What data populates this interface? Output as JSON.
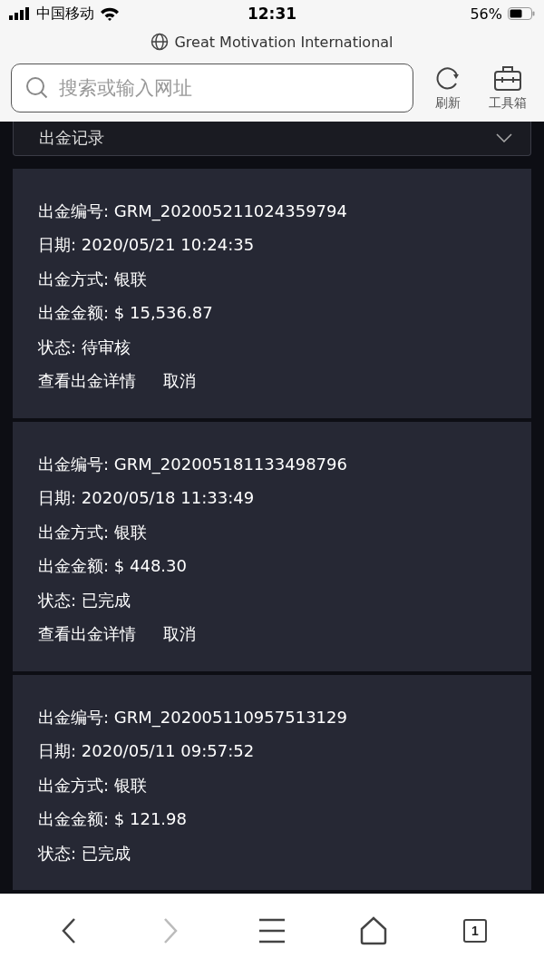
{
  "status_bar": {
    "carrier": "中国移动",
    "time": "12:31",
    "battery": "56%"
  },
  "site_title": "Great Motivation International",
  "search": {
    "placeholder": "搜索或输入网址"
  },
  "toolbar": [
    {
      "kind": "refresh",
      "label": "刷新"
    },
    {
      "kind": "toolbox",
      "label": "工具箱"
    }
  ],
  "dropdown": {
    "label": "出金记录"
  },
  "records": [
    {
      "fields": [
        {
          "label": "出金编号:",
          "value": "GRM_202005211024359794"
        },
        {
          "label": "日期:",
          "value": "2020/05/21 10:24:35"
        },
        {
          "label": "出金方式:",
          "value": "银联"
        },
        {
          "label": "出金金额:",
          "value": "$ 15,536.87"
        },
        {
          "label": "状态:",
          "value": "待审核"
        }
      ],
      "actions": [
        "查看出金详情",
        "取消"
      ]
    },
    {
      "fields": [
        {
          "label": "出金编号:",
          "value": "GRM_202005181133498796"
        },
        {
          "label": "日期:",
          "value": "2020/05/18 11:33:49"
        },
        {
          "label": "出金方式:",
          "value": "银联"
        },
        {
          "label": "出金金额:",
          "value": "$ 448.30"
        },
        {
          "label": "状态:",
          "value": "已完成"
        }
      ],
      "actions": [
        "查看出金详情",
        "取消"
      ]
    },
    {
      "fields": [
        {
          "label": "出金编号:",
          "value": "GRM_202005110957513129"
        },
        {
          "label": "日期:",
          "value": "2020/05/11 09:57:52"
        },
        {
          "label": "出金方式:",
          "value": "银联"
        },
        {
          "label": "出金金额:",
          "value": "$ 121.98"
        },
        {
          "label": "状态:",
          "value": "已完成"
        }
      ]
    }
  ],
  "bottom_bar": [
    {
      "kind": "back",
      "disabled": false
    },
    {
      "kind": "forward",
      "disabled": true
    },
    {
      "kind": "menu",
      "disabled": false
    },
    {
      "kind": "home",
      "disabled": false
    },
    {
      "kind": "tabs",
      "disabled": false,
      "label": "1"
    }
  ]
}
